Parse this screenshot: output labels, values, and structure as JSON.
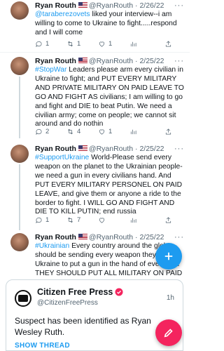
{
  "tweets": [
    {
      "name": "Ryan Routh",
      "handle": "@RyanRouth",
      "date": "· 2/26/22",
      "more": "···",
      "mention": "@taraberezovets",
      "body": " liked your interview--i am willing to come to Ukraine to fight.....respond and I will come",
      "counts": {
        "reply": "1",
        "retweet": "1",
        "like": "1",
        "views": ""
      }
    },
    {
      "name": "Ryan Routh",
      "handle": "@RyanRouth",
      "date": "· 2/25/22",
      "more": "···",
      "hashtag": "#StopWar",
      "body": " Leaders please arm every civilian in Ukraine to fight; and PUT EVERY MILITARY AND PRIVATE MILITARY ON PAID LEAVE TO GO AND FIGHT AS civilians; I am willing to go and fight and DIE to beat Putin.  We need a civilian army; come on people; we cannot sit around and do nothin",
      "counts": {
        "reply": "2",
        "retweet": "4",
        "like": "1",
        "views": ""
      }
    },
    {
      "name": "Ryan Routh",
      "handle": "@RyanRouth",
      "date": "· 2/25/22",
      "more": "···",
      "hashtag": "#SupportUkraine",
      "body": " World-Please send every weapon on the planet to the Ukrainian people-we need a gun in every civilians hand. And PUT EVERY MILITARY PERSONEL ON PAID LEAVE, and give them or anyone a ride to the border to fight.  I WILL GO AND FIGHT AND DIE TO KILL PUTIN; end russia",
      "counts": {
        "reply": "1",
        "retweet": "7",
        "like": "",
        "views": ""
      }
    },
    {
      "name": "Ryan Routh",
      "handle": "@RyanRouth",
      "date": "· 2/25/22",
      "more": "···",
      "hashtag": "#Ukrainian",
      "body": " Every country around the globe should be sending every weapon they have to Ukraine to put a gun in the hand of every and THEY SHOULD PUT ALL MILITARY ON PAID"
    }
  ],
  "quote_card": {
    "name": "Citizen Free Press",
    "handle": "@CitizenFreePress",
    "time": "1h",
    "text": "Suspect has been identified as Ryan Wesley Ruth.",
    "link": "SHOW THREAD"
  },
  "colors": {
    "accent": "#1d9bf0",
    "fab_secondary": "#f4245e",
    "verified": "#f4245e"
  },
  "icons": [
    "reply-icon",
    "retweet-icon",
    "like-icon",
    "views-icon",
    "share-icon",
    "compose-icon"
  ]
}
